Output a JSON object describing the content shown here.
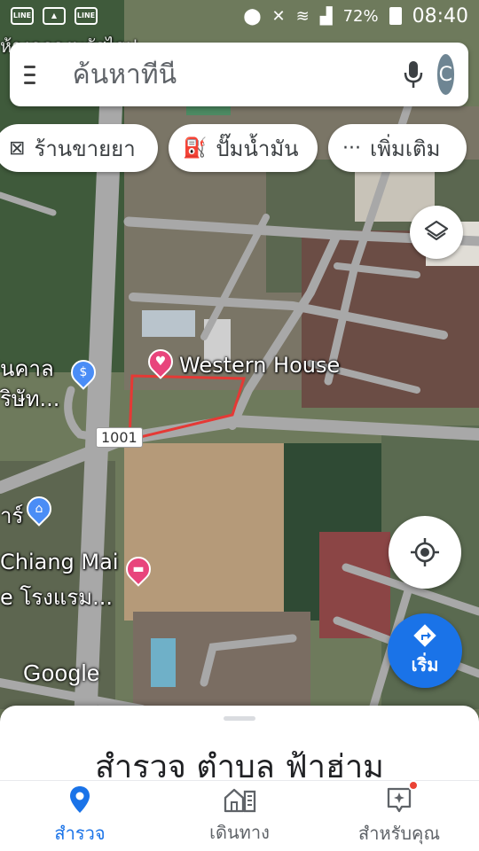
{
  "status_bar": {
    "left_icons": [
      "line-icon",
      "gallery-icon",
      "line-icon"
    ],
    "battery": "72%",
    "time": "08:40"
  },
  "search": {
    "placeholder": "ค้นหาที่นี่",
    "avatar_letter": "C"
  },
  "chips": [
    {
      "label": "ร้านขายยา",
      "icon": "pharmacy-icon"
    },
    {
      "label": "ปั๊มน้ำมัน",
      "icon": "gas-station-icon"
    },
    {
      "label": "เพิ่มเติม",
      "icon": "more-icon"
    }
  ],
  "map": {
    "labels": {
      "western_house": "Western House",
      "top_left": "ห้างฉลองพลัสไฮป",
      "bank_line1": "ินคาล",
      "bank_line2": "ริษัท...",
      "shop": "าร์",
      "hotel_line1": "Chiang Mai",
      "hotel_line2": "e โรงแรม...",
      "road_number": "1001",
      "google": "Google"
    }
  },
  "start_button": {
    "label": "เริ่ม"
  },
  "sheet": {
    "title": "สำรวจ ตำบล ฟ้าฮ่าม"
  },
  "nav": {
    "explore": "สำรวจ",
    "go": "เดินทาง",
    "for_you": "สำหรับคุณ"
  },
  "colors": {
    "accent": "#1a73e8",
    "boundary": "#e53935",
    "pin_pink": "#e8457c",
    "pin_blue": "#4a8df6"
  }
}
